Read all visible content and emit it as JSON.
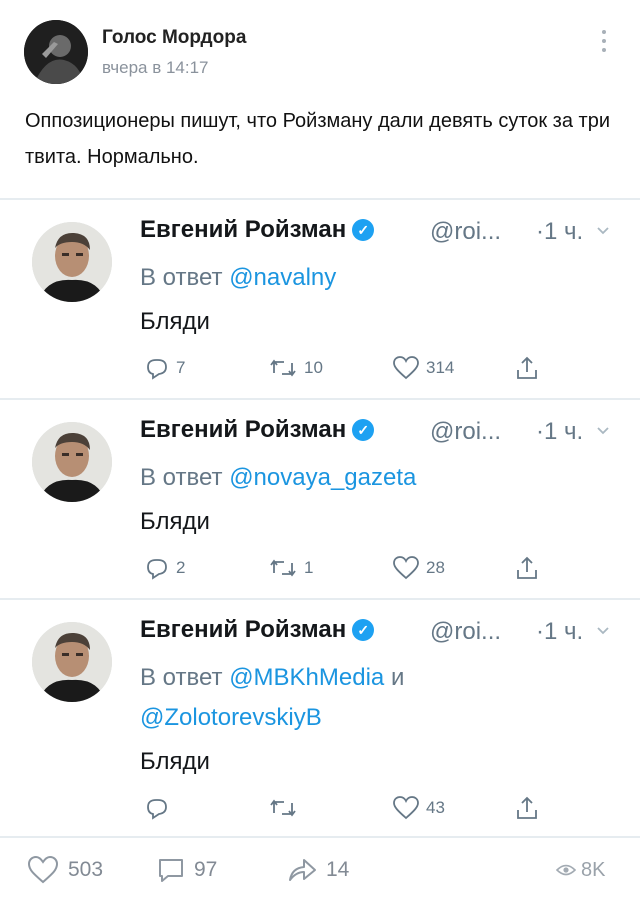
{
  "post": {
    "author": "Голос Мордора",
    "time": "вчера в 14:17",
    "text": "Оппозиционеры пишут, что Ройзману дали девять суток за три твита. Нормально."
  },
  "tweets": [
    {
      "name": "Евгений Ройзман",
      "handle": "@roi...",
      "time": "·1 ч.",
      "reply_prefix": "В ответ",
      "mentions": "@navalny",
      "body": "Бляди",
      "replies": "7",
      "retweets": "10",
      "likes": "314"
    },
    {
      "name": "Евгений Ройзман",
      "handle": "@roi...",
      "time": "·1 ч.",
      "reply_prefix": "В ответ",
      "mentions": "@novaya_gazeta",
      "body": "Бляди",
      "replies": "2",
      "retweets": "1",
      "likes": "28"
    },
    {
      "name": "Евгений Ройзман",
      "handle": "@roi...",
      "time": "·1 ч.",
      "reply_prefix": "В ответ",
      "mentions": "@MBKhMedia",
      "mentions_join": "и",
      "mentions_2": "@ZolotorevskiyB",
      "body": "Бляди",
      "replies": "",
      "retweets": "",
      "likes": "43"
    }
  ],
  "footer": {
    "likes": "503",
    "comments": "97",
    "shares": "14",
    "views": "8K"
  },
  "colors": {
    "accent": "#1b95e0",
    "verified": "#1da1f2",
    "muted": "#657786"
  }
}
